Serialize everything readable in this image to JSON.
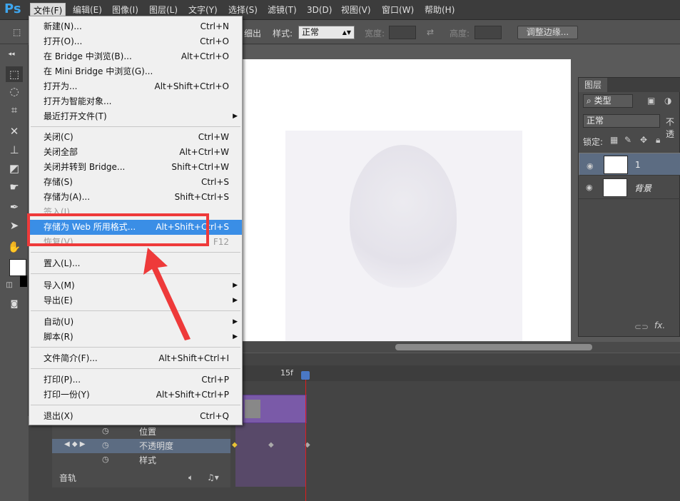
{
  "app": {
    "logo": "Ps"
  },
  "menubar": {
    "items": [
      "文件(F)",
      "编辑(E)",
      "图像(I)",
      "图层(L)",
      "文字(Y)",
      "选择(S)",
      "滤镜(T)",
      "3D(D)",
      "视图(V)",
      "窗口(W)",
      "帮助(H)"
    ],
    "active_index": 0
  },
  "options": {
    "feather_tail": "细出",
    "style_label": "样式:",
    "style_value": "正常",
    "width_label": "宽度:",
    "height_label": "高度:",
    "refine_edge": "调整边缘..."
  },
  "file_menu": {
    "items": [
      {
        "label": "新建(N)...",
        "shortcut": "Ctrl+N"
      },
      {
        "label": "打开(O)...",
        "shortcut": "Ctrl+O"
      },
      {
        "label": "在 Bridge 中浏览(B)...",
        "shortcut": "Alt+Ctrl+O"
      },
      {
        "label": "在 Mini Bridge 中浏览(G)...",
        "shortcut": ""
      },
      {
        "label": "打开为...",
        "shortcut": "Alt+Shift+Ctrl+O"
      },
      {
        "label": "打开为智能对象...",
        "shortcut": ""
      },
      {
        "label": "最近打开文件(T)",
        "shortcut": "",
        "submenu": true
      },
      {
        "label": "关闭(C)",
        "shortcut": "Ctrl+W"
      },
      {
        "label": "关闭全部",
        "shortcut": "Alt+Ctrl+W"
      },
      {
        "label": "关闭并转到 Bridge...",
        "shortcut": "Shift+Ctrl+W"
      },
      {
        "label": "存储(S)",
        "shortcut": "Ctrl+S"
      },
      {
        "label": "存储为(A)...",
        "shortcut": "Shift+Ctrl+S"
      },
      {
        "label": "签入(I)...",
        "shortcut": ""
      },
      {
        "label": "存储为 Web 所用格式...",
        "shortcut": "Alt+Shift+Ctrl+S"
      },
      {
        "label": "恢复(V)",
        "shortcut": "F12"
      },
      {
        "label": "置入(L)...",
        "shortcut": ""
      },
      {
        "label": "导入(M)",
        "shortcut": "",
        "submenu": true
      },
      {
        "label": "导出(E)",
        "shortcut": "",
        "submenu": true
      },
      {
        "label": "自动(U)",
        "shortcut": "",
        "submenu": true
      },
      {
        "label": "脚本(R)",
        "shortcut": "",
        "submenu": true
      },
      {
        "label": "文件简介(F)...",
        "shortcut": "Alt+Shift+Ctrl+I"
      },
      {
        "label": "打印(P)...",
        "shortcut": "Ctrl+P"
      },
      {
        "label": "打印一份(Y)",
        "shortcut": "Alt+Shift+Ctrl+P"
      },
      {
        "label": "退出(X)",
        "shortcut": "Ctrl+Q"
      }
    ],
    "highlighted_index": 13
  },
  "layers_panel": {
    "tab": "图层",
    "filter": "类型",
    "blend_mode": "正常",
    "opacity_label": "不透",
    "lock_label": "锁定:",
    "layers": [
      {
        "name": "1",
        "selected": true
      },
      {
        "name": "背景",
        "selected": false
      }
    ],
    "fx_label": "fx."
  },
  "timeline": {
    "frame_label": "15f",
    "props": [
      "位置",
      "不透明度",
      "样式"
    ],
    "audio_label": "音轨"
  }
}
